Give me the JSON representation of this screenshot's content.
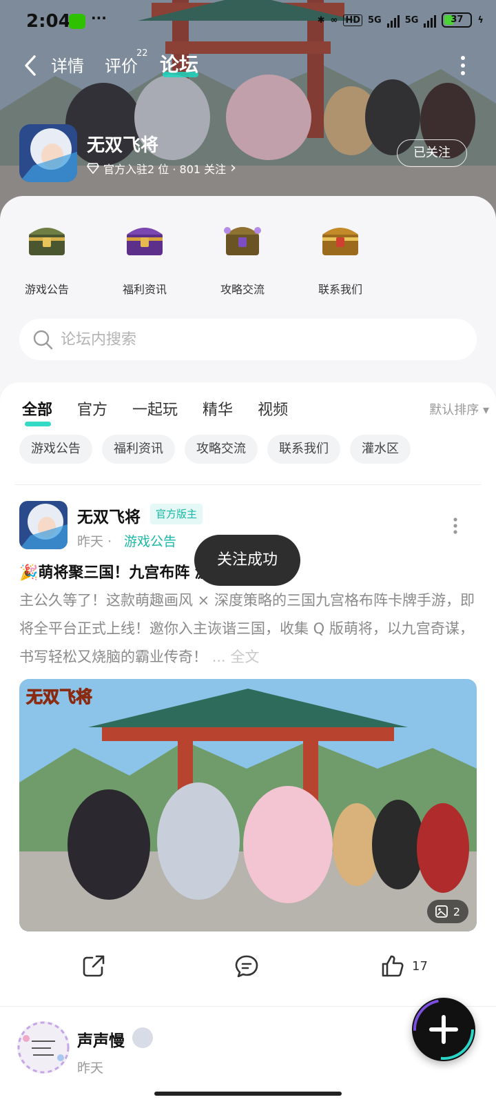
{
  "status_bar": {
    "time": "2:04",
    "dots": "···",
    "hd": "HD",
    "net1": "5G",
    "net2": "5G",
    "battery": "37"
  },
  "nav": {
    "tab_detail": "详情",
    "tab_review": "评价",
    "review_count": "22",
    "tab_forum": "论坛"
  },
  "game": {
    "name": "无双飞将",
    "meta": "官方入驻2 位 · 801 关注",
    "meta_arrow": "›",
    "follow_label": "已关注"
  },
  "categories": [
    {
      "label": "游戏公告",
      "color": "#5a6b3a"
    },
    {
      "label": "福利资讯",
      "color": "#6b3fa0"
    },
    {
      "label": "攻略交流",
      "color": "#8a6a2a"
    },
    {
      "label": "联系我们",
      "color": "#b07a20"
    }
  ],
  "search": {
    "placeholder": "论坛内搜索"
  },
  "filter_tabs": [
    "全部",
    "官方",
    "一起玩",
    "精华",
    "视频"
  ],
  "sort_label": "默认排序 ▾",
  "chips": [
    "游戏公告",
    "福利资讯",
    "攻略交流",
    "联系我们",
    "灌水区"
  ],
  "post": {
    "author": "无双飞将",
    "badge": "官方版主",
    "time": "昨天",
    "separator": "·",
    "category": "游戏公告",
    "title": "🎉萌将聚三国！九宫布阵 激情开服✨",
    "body": "主公久等了！这款萌趣画风 × 深度策略的三国九宫格布阵卡牌手游，即将全平台正式上线！邀你入主诙谐三国，收集 Q 版萌将，以九宫奇谋，书写轻松又烧脑的霸业传奇！",
    "full_text": "... 全文",
    "image_logo": "无双飞将",
    "image_count": "2",
    "like_count": "17"
  },
  "toast": "关注成功",
  "post2": {
    "author": "声声慢",
    "time": "昨天"
  },
  "colors": {
    "accent": "#1fd6c0",
    "badge_text": "#19b8a6"
  }
}
